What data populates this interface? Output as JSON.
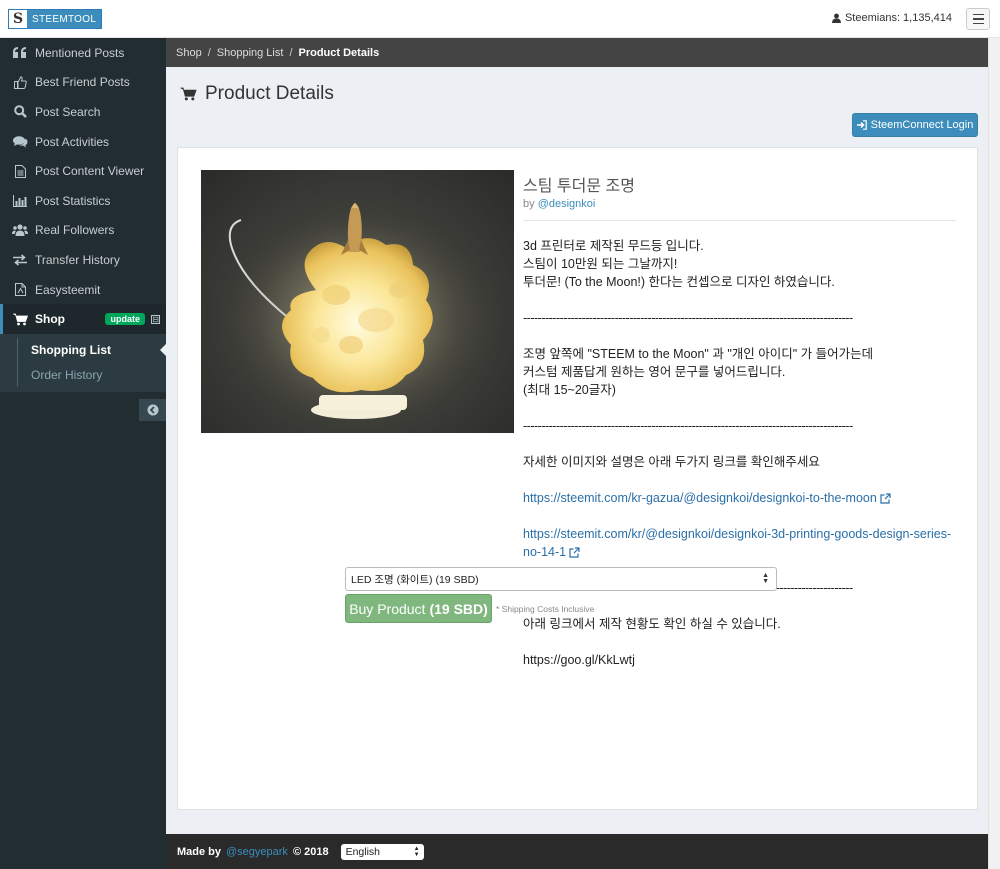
{
  "brand": {
    "letter": "S",
    "name": "STEEMTOOL"
  },
  "header": {
    "steemians_label": "Steemians: 1,135,414"
  },
  "sidebar": {
    "items": [
      {
        "label": "Mentioned Posts",
        "icon": "quote-icon"
      },
      {
        "label": "Best Friend Posts",
        "icon": "thumbs-up-icon"
      },
      {
        "label": "Post Search",
        "icon": "search-icon"
      },
      {
        "label": "Post Activities",
        "icon": "comments-icon"
      },
      {
        "label": "Post Content Viewer",
        "icon": "document-icon"
      },
      {
        "label": "Post Statistics",
        "icon": "bar-chart-icon"
      },
      {
        "label": "Real Followers",
        "icon": "users-icon"
      },
      {
        "label": "Transfer History",
        "icon": "exchange-icon"
      },
      {
        "label": "Easysteemit",
        "icon": "file-icon"
      },
      {
        "label": "Shop",
        "icon": "cart-icon",
        "badge": "update",
        "collapse": "⊟"
      }
    ],
    "submenu": [
      {
        "label": "Shopping List",
        "active": true
      },
      {
        "label": "Order History",
        "active": false
      }
    ]
  },
  "breadcrumb": {
    "items": [
      "Shop",
      "Shopping List"
    ],
    "current": "Product Details"
  },
  "page": {
    "title": "Product Details",
    "login_button": "SteemConnect Login"
  },
  "product": {
    "name": "스팀 투더문 조명",
    "by_prefix": "by",
    "author": "@designkoi",
    "description": [
      "3d 프린터로 제작된 무드등 입니다.",
      "스팀이 10만원 되는 그날까지!",
      "투더문! (To the Moon!) 한다는 컨셉으로 디자인 하였습니다.",
      "",
      "------------------------------------------------------------------------------------------",
      "",
      "조명 앞쪽에 \"STEEM to the Moon\" 과 \"개인 아이디\" 가 들어가는데",
      "커스텀 제품답게 원하는 영어 문구를 넣어드립니다.",
      "(최대 15~20글자)",
      "",
      "------------------------------------------------------------------------------------------",
      "",
      "자세한 이미지와 설명은 아래 두가지 링크를 확인해주세요",
      ""
    ],
    "link1": "https://steemit.com/kr-gazua/@designkoi/designkoi-to-the-moon",
    "link2": "https://steemit.com/kr/@designkoi/designkoi-3d-printing-goods-design-series-no-14-1",
    "description_after": [
      "------------------------------------------------------------------------------------------",
      "",
      "아래 링크에서 제작 현황도 확인 하실 수 있습니다.",
      "",
      "https://goo.gl/KkLwtj"
    ],
    "option_selected": "LED 조명 (화이트) (19 SBD)",
    "buy_label": "Buy Product",
    "buy_price": "(19 SBD)",
    "shipping_note": "* Shipping Costs Inclusive"
  },
  "footer": {
    "made_by": "Made by",
    "author": "@segyepark",
    "copyright": "© 2018",
    "language": "English"
  },
  "colors": {
    "accent": "#3c8dbc",
    "sidebar": "#222d32",
    "badge": "#00a65a",
    "buy": "#7fb77e"
  }
}
